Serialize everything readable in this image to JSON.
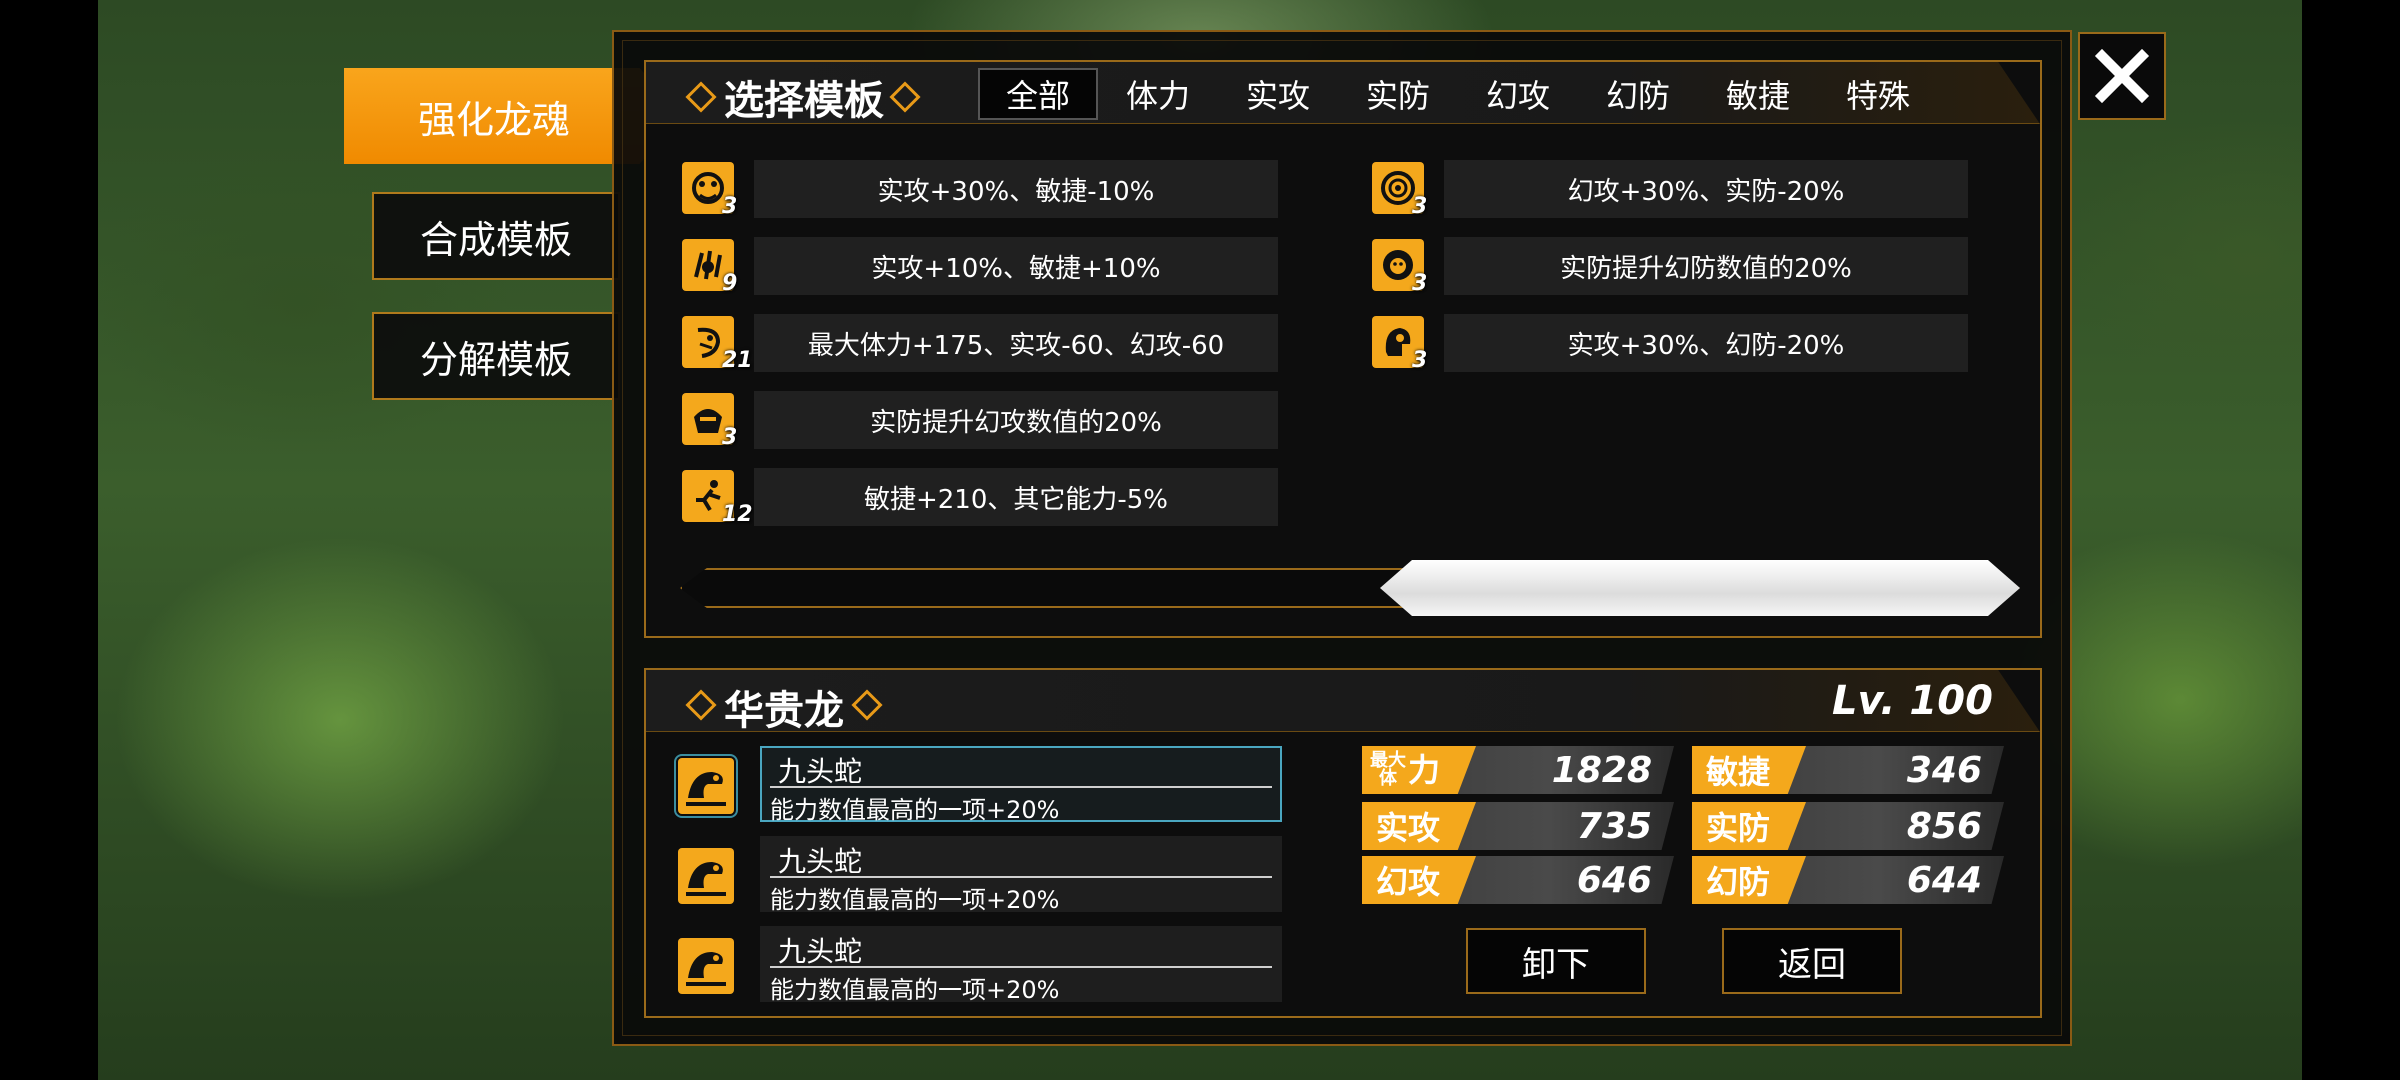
{
  "nav": {
    "tabs": [
      {
        "label": "强化龙魂"
      },
      {
        "label": "合成模板"
      },
      {
        "label": "分解模板"
      }
    ]
  },
  "select_panel": {
    "title": "选择模板",
    "filters": [
      "全部",
      "体力",
      "实攻",
      "实防",
      "幻攻",
      "幻防",
      "敏捷",
      "特殊"
    ],
    "active_filter": "全部",
    "templates_left": [
      {
        "icon": "fist-icon",
        "count": "3",
        "text": "实攻+30%、敏捷-10%"
      },
      {
        "icon": "claw-icon",
        "count": "9",
        "text": "实攻+10%、敏捷+10%"
      },
      {
        "icon": "dragon-head-icon",
        "count": "21",
        "text": "最大体力+175、实攻-60、幻攻-60"
      },
      {
        "icon": "hooded-figure-icon",
        "count": "3",
        "text": "实防提升幻攻数值的20%"
      },
      {
        "icon": "runner-icon",
        "count": "12",
        "text": "敏捷+210、其它能力-5%"
      }
    ],
    "templates_right": [
      {
        "icon": "eye-icon",
        "count": "3",
        "text": "幻攻+30%、实防-20%"
      },
      {
        "icon": "lion-icon",
        "count": "3",
        "text": "实防提升幻防数值的20%"
      },
      {
        "icon": "helmet-icon",
        "count": "3",
        "text": "实攻+30%、幻防-20%"
      }
    ],
    "scroll_position": 0.65
  },
  "dragon_panel": {
    "name": "华贵龙",
    "level": "Lv. 100",
    "slots": [
      {
        "icon": "hydra-icon",
        "name": "九头蛇",
        "desc": "能力数值最高的一项+20%",
        "selected": true
      },
      {
        "icon": "hydra-icon",
        "name": "九头蛇",
        "desc": "能力数值最高的一项+20%",
        "selected": false
      },
      {
        "icon": "hydra-icon",
        "name": "九头蛇",
        "desc": "能力数值最高的一项+20%",
        "selected": false
      }
    ],
    "stats": {
      "hp": {
        "label_top": "最大",
        "label_mid": "体",
        "label_big": "力",
        "value": "1828"
      },
      "agi": {
        "label": "敏捷",
        "value": "346"
      },
      "patk": {
        "label": "实攻",
        "value": "735"
      },
      "pdef": {
        "label": "实防",
        "value": "856"
      },
      "matk": {
        "label": "幻攻",
        "value": "646"
      },
      "mdef": {
        "label": "幻防",
        "value": "644"
      }
    },
    "buttons": {
      "unequip": "卸下",
      "back": "返回"
    }
  },
  "colors": {
    "accent": "#f4a81c",
    "border": "#9a6a1a",
    "selected": "#4aa6c0"
  }
}
